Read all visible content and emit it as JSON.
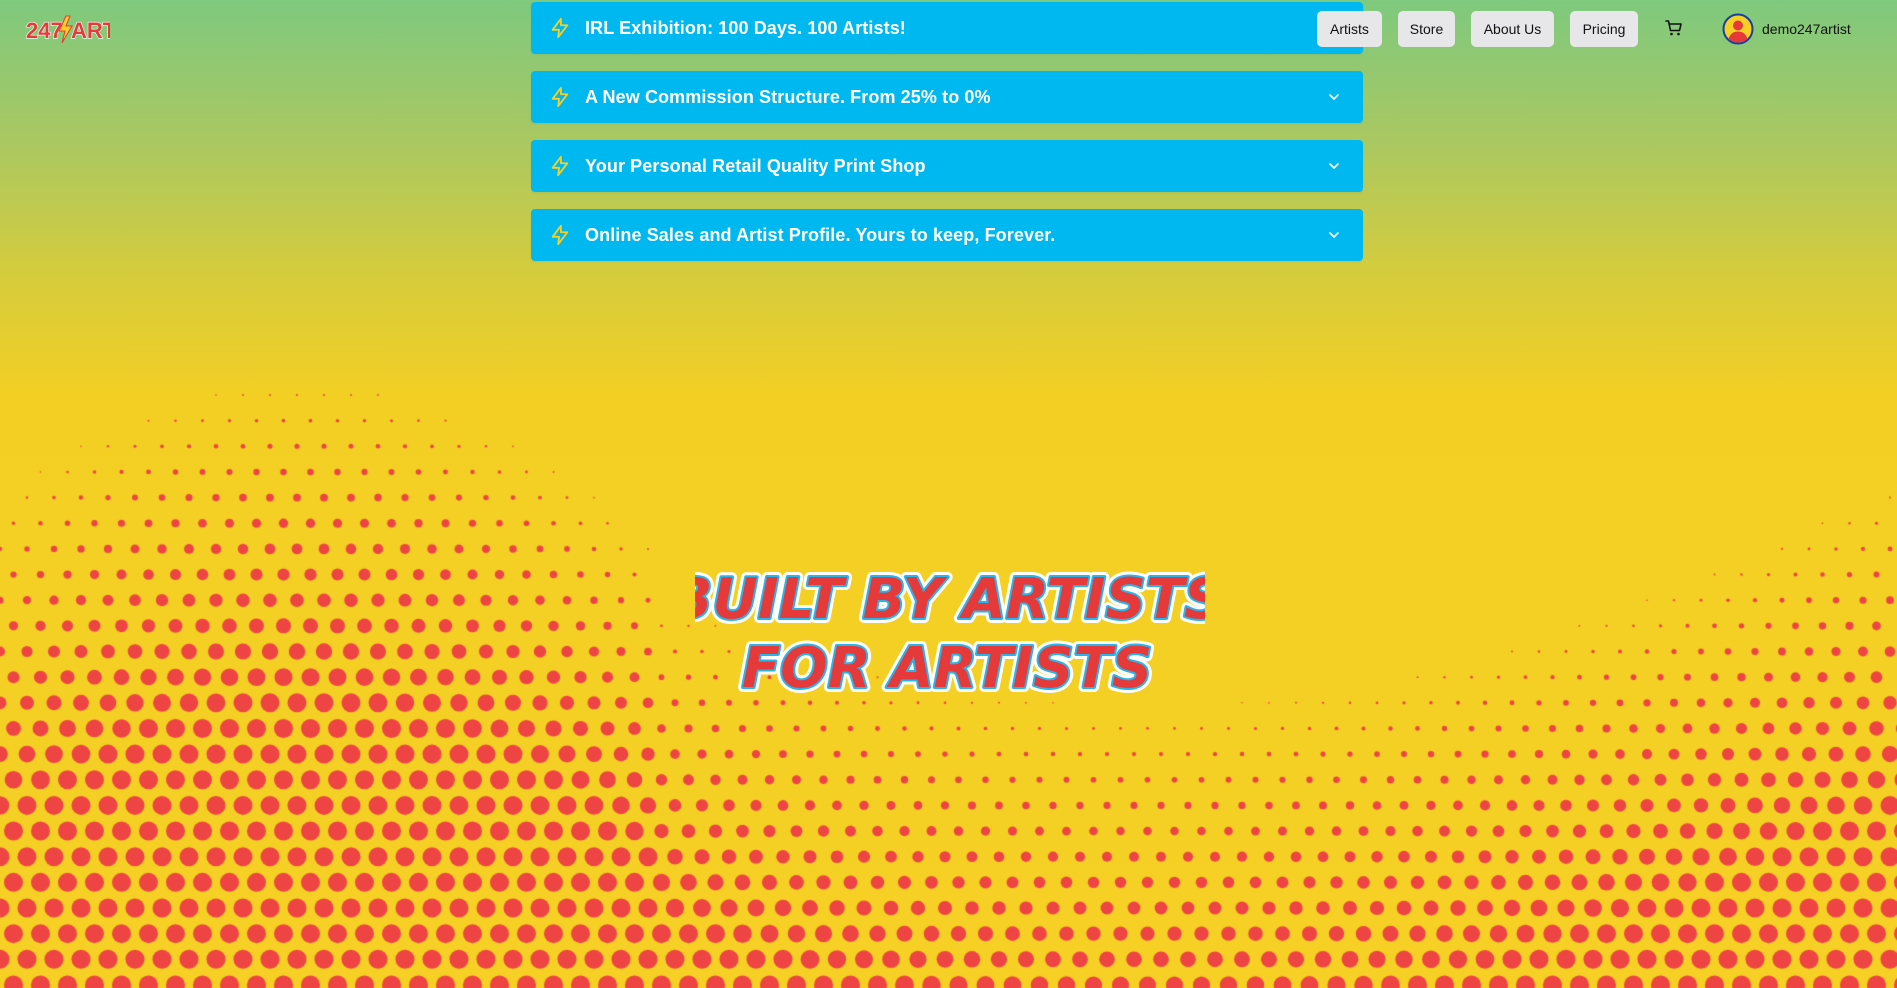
{
  "brand": {
    "logo_text_part1": "247",
    "logo_text_part2": "ART"
  },
  "announcements": [
    {
      "title": "IRL Exhibition: 100 Days. 100 Artists!",
      "icon": "bolt-icon",
      "expandable": false
    },
    {
      "title": "A New Commission Structure. From 25% to 0%",
      "icon": "bolt-icon",
      "expandable": true
    },
    {
      "title": "Your Personal Retail Quality Print Shop",
      "icon": "bolt-icon",
      "expandable": true
    },
    {
      "title": "Online Sales and Artist Profile. Yours to keep, Forever.",
      "icon": "bolt-icon",
      "expandable": true
    }
  ],
  "nav": {
    "items": [
      {
        "label": "Artists"
      },
      {
        "label": "Store"
      },
      {
        "label": "About Us"
      },
      {
        "label": "Pricing"
      }
    ],
    "cart_icon": "cart-icon"
  },
  "user": {
    "name": "demo247artist",
    "avatar_icon": "user-avatar-icon"
  },
  "hero": {
    "line1": "BUILT BY ARTISTS",
    "line2": "FOR ARTISTS"
  },
  "colors": {
    "banner": "#00b8f0",
    "bolt": "#f6d024",
    "dots": "#ee4444",
    "hero_fill": "#e63a3a",
    "hero_outline": "#2ab4e8",
    "gradient_top": "#7ec97e",
    "gradient_bottom": "#f6d024"
  }
}
